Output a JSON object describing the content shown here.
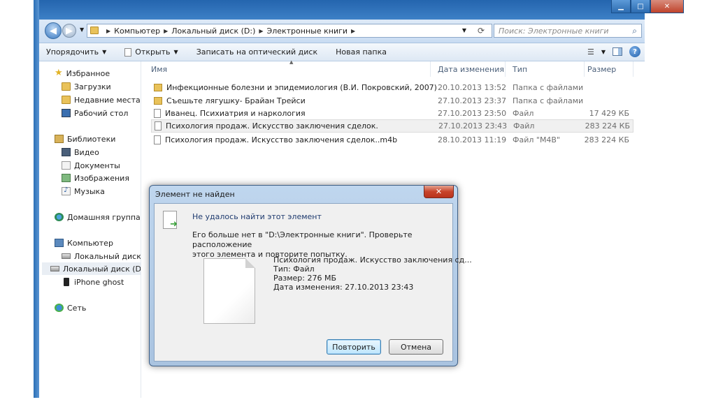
{
  "window": {
    "minimize_glyph": "▁",
    "maximize_glyph": "□",
    "close_glyph": "✕"
  },
  "address_bar": {
    "back_glyph": "◀",
    "forward_glyph": "▶",
    "crumbs": [
      "Компьютер",
      "Локальный диск (D:)",
      "Электронные книги"
    ],
    "search_placeholder": "Поиск: Электронные книги"
  },
  "toolbar": {
    "organize": "Упорядочить",
    "open": "Открыть",
    "burn": "Записать на оптический диск",
    "new_folder": "Новая папка"
  },
  "nav": {
    "favorites": "Избранное",
    "downloads": "Загрузки",
    "recent": "Недавние места",
    "desktop": "Рабочий стол",
    "libraries": "Библиотеки",
    "video": "Видео",
    "documents": "Документы",
    "pictures": "Изображения",
    "music": "Музыка",
    "homegroup": "Домашняя группа",
    "computer": "Компьютер",
    "disk_c": "Локальный диск (C",
    "disk_d": "Локальный диск (D",
    "iphone": "iPhone ghost",
    "network": "Сеть"
  },
  "columns": {
    "name": "Имя",
    "date": "Дата изменения",
    "type": "Тип",
    "size": "Размер"
  },
  "files": [
    {
      "name": "Инфекционные болезни и эпидемиология (В.И. Покровский, 2007)",
      "date": "20.10.2013 13:52",
      "type": "Папка с файлами",
      "size": "",
      "kind": "folder"
    },
    {
      "name": "Съешьте лягушку- Брайан Трейси",
      "date": "27.10.2013 23:37",
      "type": "Папка с файлами",
      "size": "",
      "kind": "folder"
    },
    {
      "name": "Иванец. Психиатрия и наркология",
      "date": "27.10.2013 23:50",
      "type": "Файл",
      "size": "17 429 КБ",
      "kind": "file"
    },
    {
      "name": "Психология продаж. Искусство заключения сделок.",
      "date": "27.10.2013 23:43",
      "type": "Файл",
      "size": "283 224 КБ",
      "kind": "file"
    },
    {
      "name": "Психология продаж. Искусство заключения сделок..m4b",
      "date": "28.10.2013 11:19",
      "type": "Файл \"M4B\"",
      "size": "283 224 КБ",
      "kind": "file"
    }
  ],
  "dialog": {
    "title": "Элемент не найден",
    "close_glyph": "✕",
    "main_text": "Не удалось найти этот элемент",
    "desc_line1": "Его больше нет в \"D:\\Электронные книги\". Проверьте расположение",
    "desc_line2": "этого элемента и повторите попытку.",
    "file_name": "Психология продаж. Искусство заключения сд...",
    "file_type": "Тип: Файл",
    "file_size": "Размер: 276 МБ",
    "file_date": "Дата изменения: 27.10.2013 23:43",
    "retry": "Повторить",
    "cancel": "Отмена"
  },
  "colors": {
    "titlebar": "#2465ae",
    "dialog_frame": "#bfd6ee",
    "close_red": "#c8442b"
  }
}
